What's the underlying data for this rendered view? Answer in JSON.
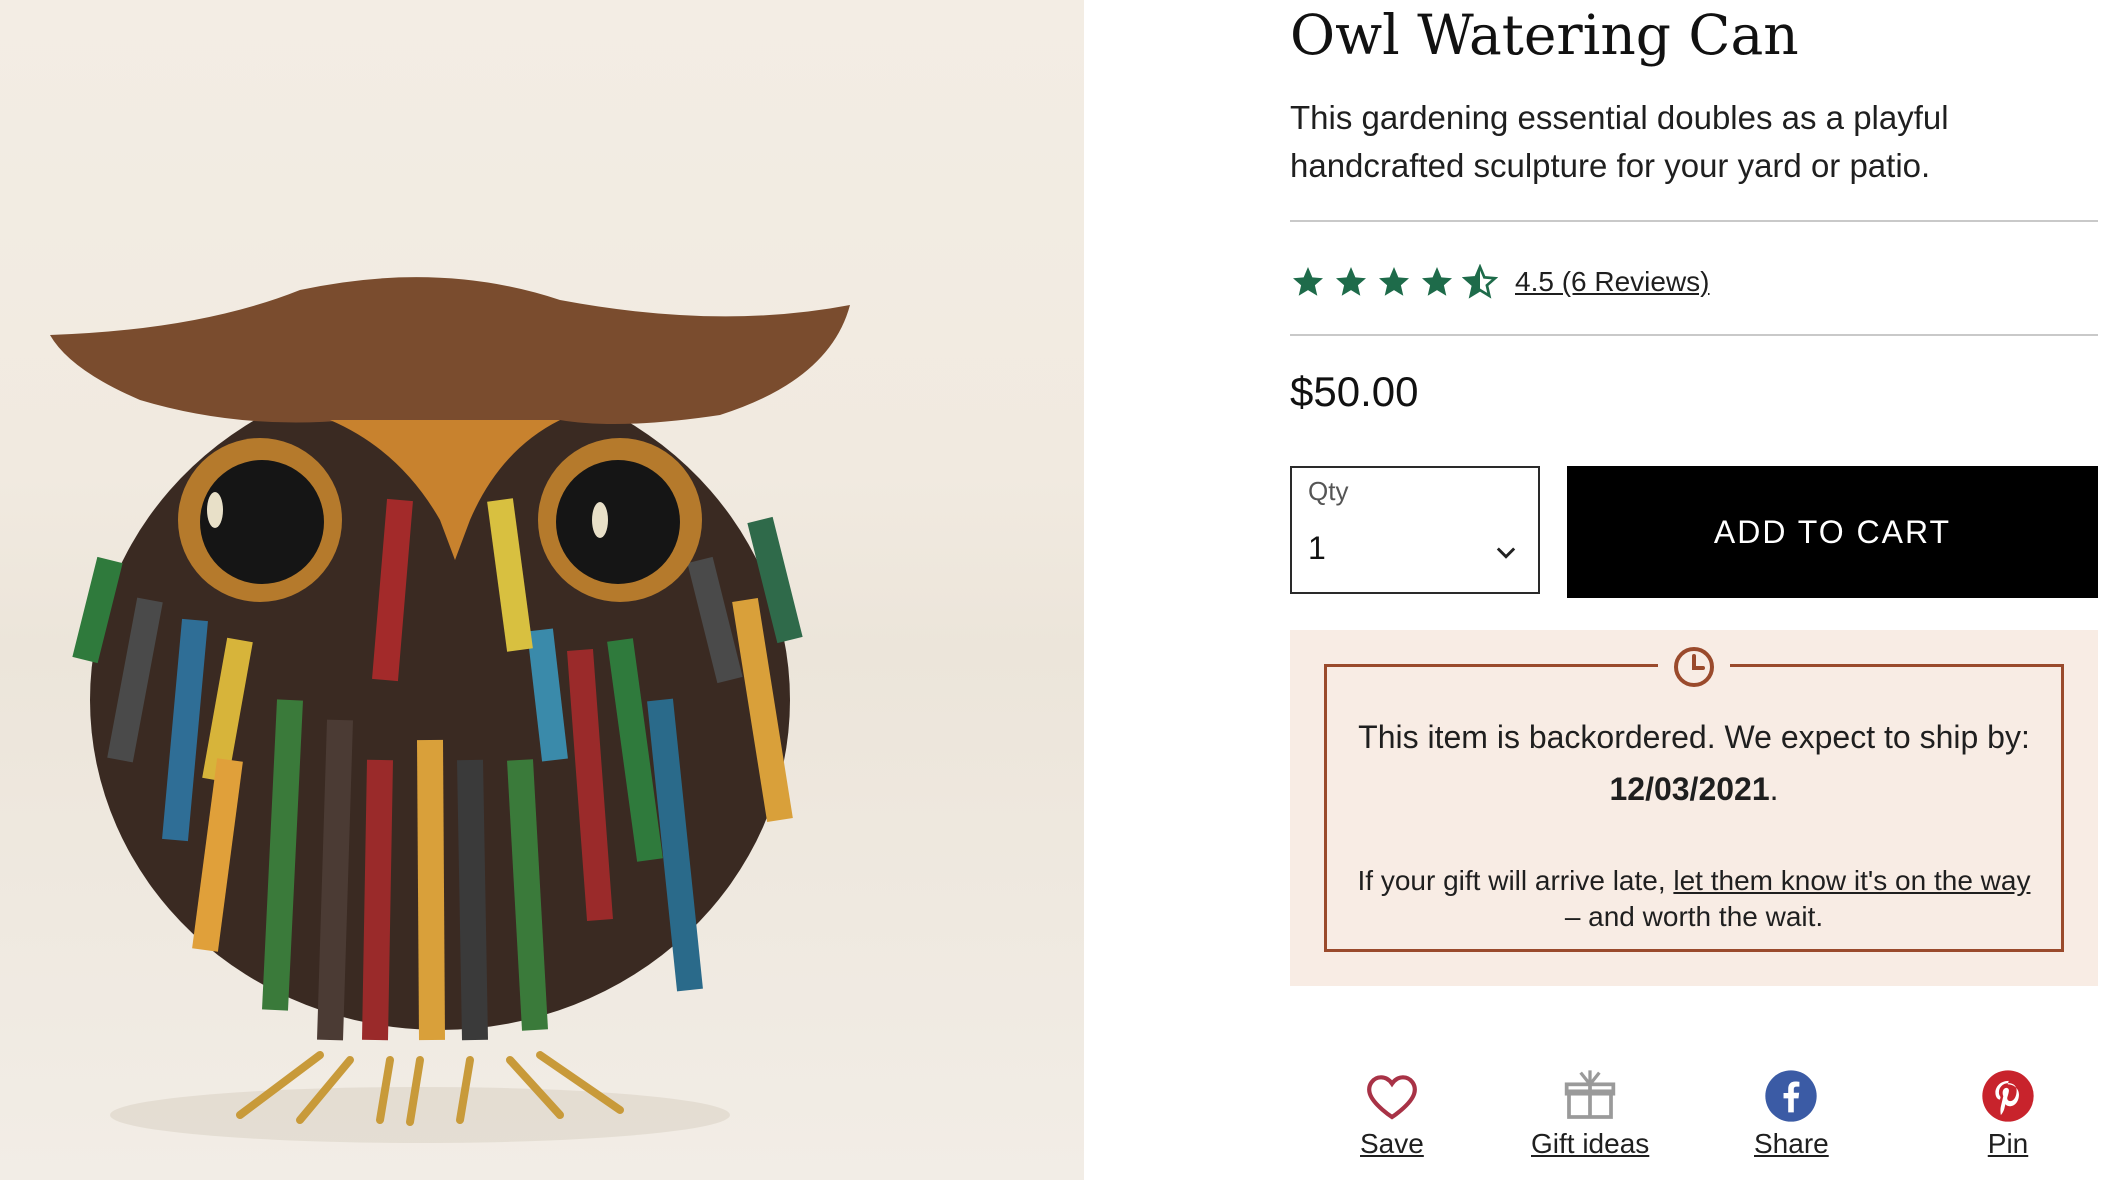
{
  "product": {
    "title": "Owl Watering Can",
    "description": "This gardening essential doubles as a playful handcrafted sculpture for your yard or patio.",
    "rating": {
      "value": 4.5,
      "max": 5,
      "link_text": "4.5 (6 Reviews)",
      "star_color": "#1e6b4a"
    },
    "price": "$50.00",
    "image_icon": "owl-sculpture-photo"
  },
  "purchase": {
    "qty_label": "Qty",
    "qty_value": "1",
    "add_to_cart": "ADD TO CART"
  },
  "notice": {
    "text_prefix": "This item is backordered. We expect to ship by: ",
    "ship_date": "12/03/2021",
    "text_suffix": ".",
    "sub_prefix": "If your gift will arrive late, ",
    "sub_link": "let them know it's on the way",
    "sub_suffix": " – and worth the wait.",
    "accent_color": "#9a4a2c"
  },
  "social": {
    "save": "Save",
    "gift_ideas": "Gift ideas",
    "share": "Share",
    "pin": "Pin"
  }
}
